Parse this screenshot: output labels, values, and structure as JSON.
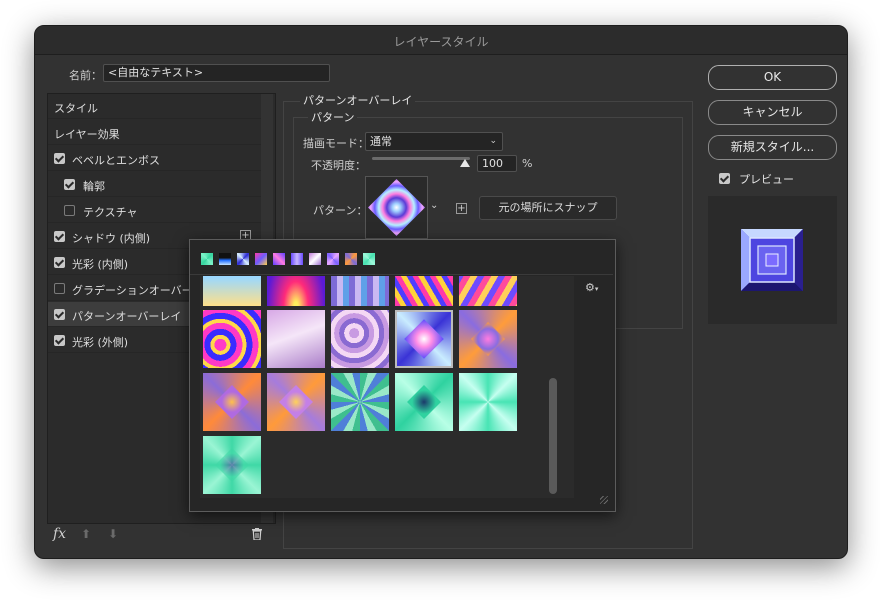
{
  "window": {
    "title": "レイヤースタイル"
  },
  "name_field": {
    "label": "名前：",
    "value": "<自由なテキスト>"
  },
  "sidebar": {
    "items": [
      {
        "label": "スタイル"
      },
      {
        "label": "レイヤー効果"
      },
      {
        "label": "ベベルとエンボス",
        "checked": true
      },
      {
        "label": "輪郭",
        "checked": true
      },
      {
        "label": "テクスチャ",
        "checked": false
      },
      {
        "label": "シャドウ (内側)",
        "checked": true
      },
      {
        "label": "光彩 (内側)",
        "checked": true
      },
      {
        "label": "グラデーションオーバーレイ",
        "checked": false
      },
      {
        "label": "パターンオーバーレイ",
        "checked": true,
        "selected": true
      },
      {
        "label": "光彩 (外側)",
        "checked": true
      }
    ],
    "footer": {
      "fx_label": "fx"
    }
  },
  "panel": {
    "section_title": "パターンオーバーレイ",
    "subsection_title": "パターン",
    "blend_mode_label": "描画モード：",
    "blend_mode_value": "通常",
    "opacity_label": "不透明度：",
    "opacity_value": "100",
    "opacity_unit": "%",
    "pattern_label": "パターン：",
    "snap_button": "元の場所にスナップ"
  },
  "buttons": {
    "ok": "OK",
    "cancel": "キャンセル",
    "new_style": "新規スタイル...",
    "preview_label": "プレビュー",
    "preview_checked": true
  },
  "pattern_picker": {
    "recent_count": 10,
    "selected_index": 8
  },
  "colors": {
    "dialog_bg": "#323232",
    "field_bg": "#242424",
    "selected_row": "#3d3d3d",
    "popup_bg": "#262626"
  }
}
